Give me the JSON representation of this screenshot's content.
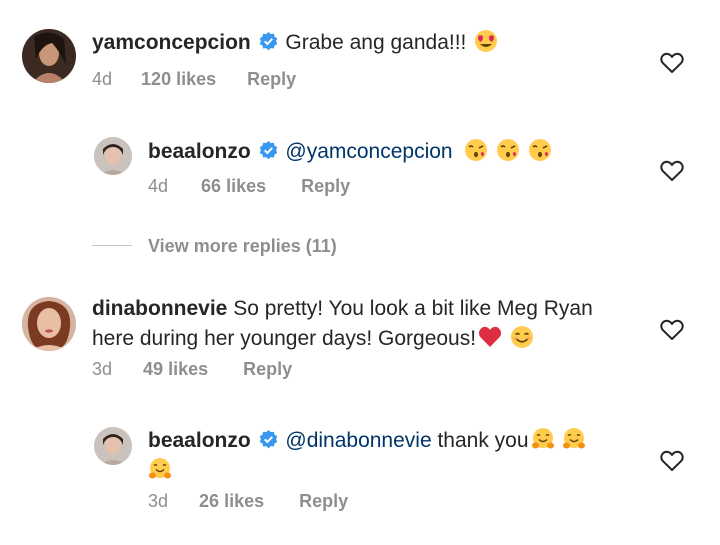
{
  "comments": [
    {
      "username": "yamconcepcion",
      "text": "Grabe ang ganda!!!",
      "emojis": [
        "heart-eyes"
      ],
      "time": "4d",
      "likes": "120 likes",
      "reply": "Reply"
    },
    {
      "username": "beaalonzo",
      "mention": "@yamconcepcion",
      "emojis": [
        "kiss",
        "kiss",
        "kiss"
      ],
      "time": "4d",
      "likes": "66 likes",
      "reply": "Reply"
    },
    {
      "username": "dinabonnevie",
      "text_line1": "So pretty! You look a bit like Meg Ryan",
      "text_line2": "here during her younger days! Gorgeous!",
      "emojis": [
        "red-heart",
        "smiling-face"
      ],
      "time": "3d",
      "likes": "49 likes",
      "reply": "Reply"
    },
    {
      "username": "beaalonzo",
      "mention": "@dinabonnevie",
      "text": " thank you",
      "emojis": [
        "hugging",
        "hugging",
        "hugging"
      ],
      "time": "3d",
      "likes": "26 likes",
      "reply": "Reply"
    }
  ],
  "view_more_replies": "View more replies (11)",
  "colors": {
    "text": "#262626",
    "meta": "#8e8e8e",
    "mention": "#003569",
    "verified": "#3897f0"
  }
}
